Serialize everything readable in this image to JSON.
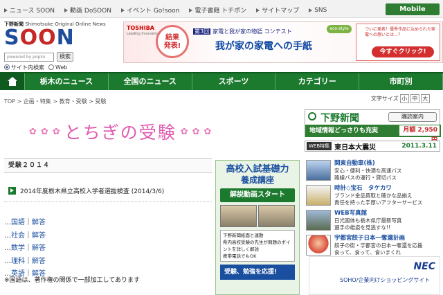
{
  "topnav": [
    {
      "label": "ニュース SOON"
    },
    {
      "label": "動画 DoSOON"
    },
    {
      "label": "イベント Go!soon"
    },
    {
      "label": "電子書籍 トチポン"
    },
    {
      "label": "サイトマップ"
    },
    {
      "label": "SNS"
    }
  ],
  "mobile_label": "Mobile",
  "logo": {
    "small_text": "下野新聞",
    "small_sub": "Shimotsuke Original Online News",
    "main_s": "S",
    "main_oo": "OO",
    "main_n": "N"
  },
  "search": {
    "placeholder": "powered by poplin",
    "button": "検索",
    "radio_site": "サイト内検索",
    "radio_web": "Web"
  },
  "banner": {
    "toshiba": "TOSHIBA",
    "tagline": "Leading Innovation >>>",
    "circle": "結果\n発表!",
    "contest_no": "第3回",
    "contest": "家電と我が家の物語 コンテスト",
    "title": "我が家の家電への手紙",
    "eco": "eco-style",
    "right_text": "ついに発表！優秀作品に込められた家電への想いとは…？",
    "right_button": "今すぐクリック!"
  },
  "nav": [
    "栃木のニュース",
    "全国のニュース",
    "スポーツ",
    "カテゴリー",
    "市町別"
  ],
  "breadcrumb": "TOP > 企画・特集 > 教育・受験 > 受験",
  "fontsize": {
    "label": "文字サイズ",
    "small": "小",
    "mid": "中",
    "large": "大"
  },
  "page_title": "とちぎの受験",
  "section_heading": "受験２０１４",
  "article": "2014年度栃木県立高校入学者選抜検査 (2014/3/6)",
  "subjects": [
    {
      "prefix": "…",
      "subject": "国語",
      "sep": "｜",
      "answer": "解答"
    },
    {
      "prefix": "…",
      "subject": "社会",
      "sep": "｜",
      "answer": "解答"
    },
    {
      "prefix": "…",
      "subject": "数学",
      "sep": "｜",
      "answer": "解答"
    },
    {
      "prefix": "…",
      "subject": "理科",
      "sep": "｜",
      "answer": "解答"
    },
    {
      "prefix": "…",
      "subject": "英語",
      "sep": "｜",
      "answer": "解答"
    }
  ],
  "note": "※国語は、著作権の関係で一部加工してあります",
  "ad_mid": {
    "h1": "高校入試基礎力",
    "h2": "養成講座",
    "video": "解説動画スタート",
    "list": [
      "下野新聞紙面と連動",
      "県内高校受験の先生が問題のポイントを詳しく解説",
      "携帯電話でもOK"
    ],
    "bottom": "受験、勉強を応援!"
  },
  "shimotsuke": {
    "name": "下野新聞",
    "subscribe": "購読案内",
    "local": "地域情報どっさりも充実",
    "price": "月額 2,950円"
  },
  "quake": {
    "tag": "WEB特集",
    "title": "東日本大震災",
    "date": "2011.3.11"
  },
  "right_items": [
    {
      "title": "関東自動車(株)",
      "d1": "安心・便利・快適な高速バス",
      "d2": "路線バスの運行・貸切バス",
      "color": "#1a4fa0"
    },
    {
      "title": "時計◇宝石　タケカワ",
      "d1": "ブランド金品買取と確かな品揃え",
      "d2": "責任を持った手厚いアフターサービス",
      "color": "#1a4fa0"
    },
    {
      "title": "WEB写真館",
      "d1": "日光国体も栃木県庁最新写真",
      "d2": "選手の雄姿を見逃すな!!",
      "color": "#1a4fa0"
    },
    {
      "title": "宇都宮餃子日本一奪還計画",
      "d1": "餃子の街・宇都宮の日本一奪還を応援",
      "d2": "食って、食って、食いまくれ",
      "color": "#1a4fa0"
    }
  ],
  "nec": {
    "logo": "NEC",
    "text": "SOHO/企業向けショッピングサイト"
  }
}
